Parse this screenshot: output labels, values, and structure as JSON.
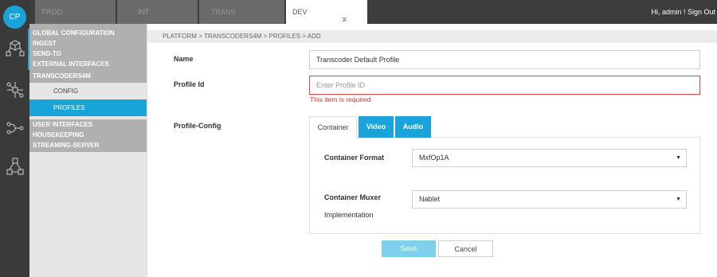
{
  "app": {
    "logo_text": "CP"
  },
  "rail": {
    "icons": [
      "cube-network-icon",
      "tree-network-icon",
      "flow-connector-icon",
      "triangle-network-icon"
    ]
  },
  "env_tabs": [
    {
      "label": "PROD",
      "active": false
    },
    {
      "label": "INT",
      "active": false
    },
    {
      "label": "TRANS",
      "active": false
    },
    {
      "label": "DEV",
      "active": true,
      "icon": "plug-icon"
    }
  ],
  "header": {
    "greeting": "Hi, admin !",
    "sign_out": "Sign Out"
  },
  "menu": {
    "items_top": [
      "GLOBAL CONFIGURATION",
      "INGEST",
      "SEND-TO",
      "EXTERNAL INTERFACES",
      "TRANSCODERS4M"
    ],
    "sub_items": [
      {
        "label": "CONFIG",
        "selected": false
      },
      {
        "label": "PROFILES",
        "selected": true
      }
    ],
    "items_bottom": [
      "USER INTERFACES",
      "HOUSEKEEPING",
      "STREAMING-SERVER"
    ]
  },
  "breadcrumb": "PLATFORM > TRANSCODERS4M > PROFILES > ADD",
  "form": {
    "name_label": "Name",
    "name_value": "Transcoder Default Profile",
    "profile_id_label": "Profile Id",
    "profile_id_placeholder": "Enter Profile ID",
    "profile_id_error": "This item is required",
    "profile_config_label": "Profile-Config",
    "tabs": [
      "Container",
      "Video",
      "Audio"
    ],
    "container_format_label": "Container Format",
    "container_format_value": "MxfOp1A",
    "container_muxer_label_line1": "Container Muxer",
    "container_muxer_label_line2": "Implementation",
    "container_muxer_value": "Nablet"
  },
  "buttons": {
    "save": "Save",
    "cancel": "Cancel"
  },
  "colors": {
    "accent": "#1aa3d9",
    "error": "#dd3333",
    "rail": "#3a3a3a",
    "topbar": "#3d3d3d"
  }
}
